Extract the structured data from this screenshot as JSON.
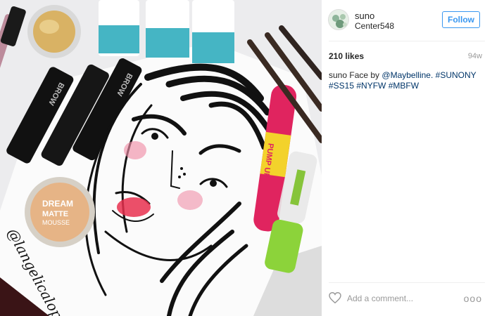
{
  "post": {
    "username": "suno",
    "location": "Center548",
    "follow_label": "Follow",
    "likes": "210 likes",
    "time_ago": "94w",
    "caption": {
      "username": "suno",
      "text": "Face by",
      "mention": "@Maybelline.",
      "hashtags": [
        "#SUNONY",
        "#SS15",
        "#NYFW",
        "#MBFW"
      ]
    },
    "comment_placeholder": "Add a comment...",
    "more_label": "ooo"
  },
  "photo": {
    "product_labels": {
      "brow_1": "BROW",
      "brow_2": "BROW",
      "jar_line_1": "DREAM",
      "jar_line_2": "MATTE",
      "jar_line_3": "MOUSSE",
      "mascara": "PUMP UP",
      "signature": "@langelicalope"
    }
  },
  "colors": {
    "link": "#003569",
    "follow_blue": "#3897f0",
    "muted": "#999999",
    "divider": "#efefef"
  },
  "icons": [
    "avatar-icon",
    "heart-icon",
    "more-options-icon"
  ]
}
